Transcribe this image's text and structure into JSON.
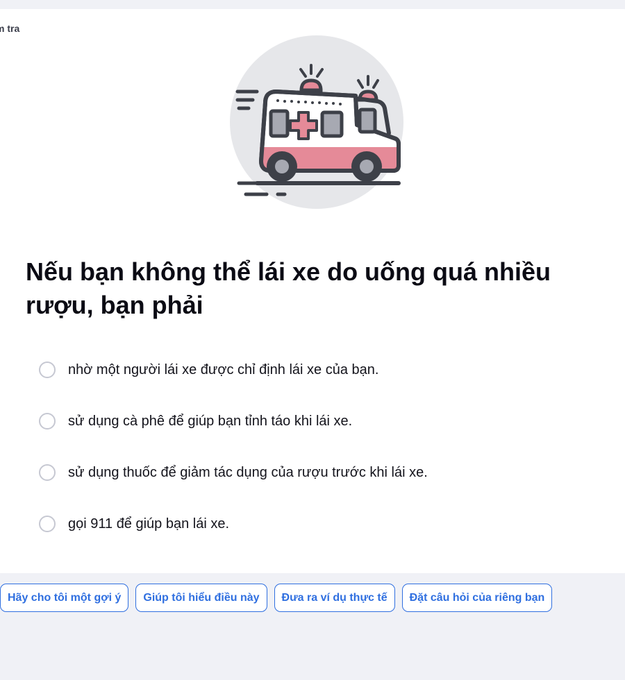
{
  "header": {
    "breadcrumb": "m tra"
  },
  "illustration": {
    "icon": "ambulance-icon",
    "colors": {
      "circle": "#e6e7ea",
      "outline": "#3d4048",
      "accent": "#e58a98"
    }
  },
  "question": {
    "text": "Nếu bạn không thể lái xe do uống quá nhiều rượu, bạn phải"
  },
  "options": [
    {
      "label": "nhờ một người lái xe được chỉ định lái xe của bạn."
    },
    {
      "label": "sử dụng cà phê để giúp bạn tỉnh táo khi lái xe."
    },
    {
      "label": "sử dụng thuốc để giảm tác dụng của rượu trước khi lái xe."
    },
    {
      "label": "gọi 911 để giúp bạn lái xe."
    }
  ],
  "actions": [
    {
      "label": "Hãy cho tôi một gợi ý"
    },
    {
      "label": "Giúp tôi hiểu điều này"
    },
    {
      "label": "Đưa ra ví dụ thực tế"
    },
    {
      "label": "Đặt câu hỏi của riêng bạn"
    }
  ],
  "colors": {
    "page_bg": "#f0f1f6",
    "card_bg": "#ffffff",
    "accent": "#2f6fe0",
    "radio_border": "#c6c8d2"
  }
}
